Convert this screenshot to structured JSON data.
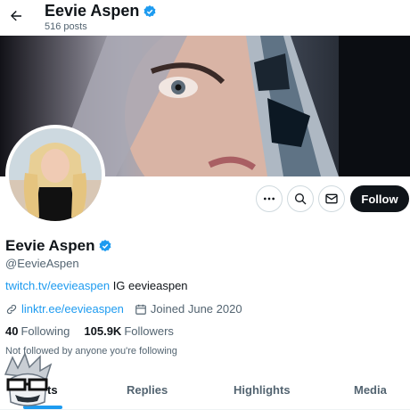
{
  "header": {
    "title": "Eevie Aspen",
    "post_count": "516 posts"
  },
  "profile": {
    "display_name": "Eevie Aspen",
    "handle": "@EevieAspen",
    "bio_link": "twitch.tv/eevieaspen",
    "bio_text": " IG eevieaspen",
    "website": "linktr.ee/eevieaspen",
    "joined": "Joined June 2020",
    "following_count": "40",
    "following_label": "Following",
    "followers_count": "105.9K",
    "followers_label": "Followers",
    "not_followed": "Not followed by anyone you're following"
  },
  "actions": {
    "follow_label": "Follow",
    "more_icon": "more-icon",
    "search_icon": "search-icon",
    "message_icon": "mail-icon"
  },
  "tabs": [
    {
      "label": "Posts",
      "visible_label": "ts"
    },
    {
      "label": "Replies"
    },
    {
      "label": "Highlights"
    },
    {
      "label": "Media"
    }
  ],
  "colors": {
    "accent": "#1d9bf0",
    "text": "#0f1419",
    "muted": "#536471",
    "follow_bg": "#0f1419"
  }
}
